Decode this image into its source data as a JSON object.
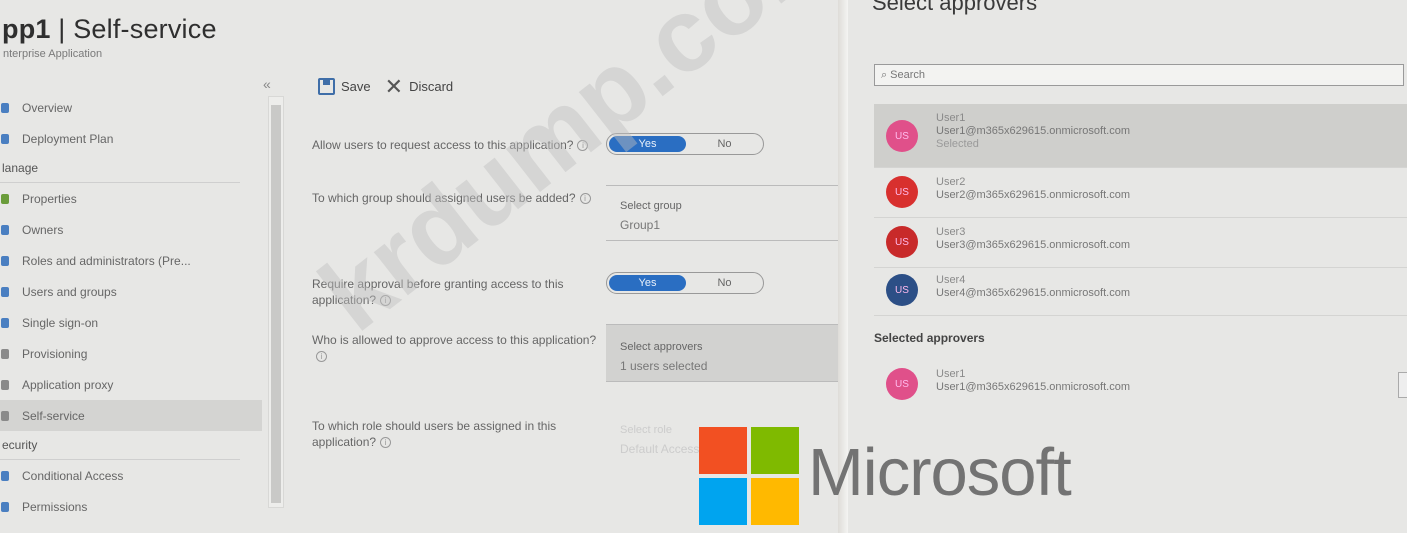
{
  "header": {
    "title_bold": "pp1",
    "title_rest": " | Self-service",
    "subtitle": "nterprise Application"
  },
  "sidebar": {
    "collapse_glyph": "«",
    "items": [
      {
        "type": "item",
        "label": "Overview",
        "color": "#4a7fc1"
      },
      {
        "type": "item",
        "label": "Deployment Plan",
        "color": "#4a7fc1"
      },
      {
        "type": "section",
        "label": "lanage"
      },
      {
        "type": "item",
        "label": "Properties",
        "color": "#6a9c3a"
      },
      {
        "type": "item",
        "label": "Owners",
        "color": "#4a7fc1"
      },
      {
        "type": "item",
        "label": "Roles and administrators (Pre...",
        "color": "#4a7fc1"
      },
      {
        "type": "item",
        "label": "Users and groups",
        "color": "#4a7fc1"
      },
      {
        "type": "item",
        "label": "Single sign-on",
        "color": "#4a7fc1"
      },
      {
        "type": "item",
        "label": "Provisioning",
        "color": "#8a8a8a"
      },
      {
        "type": "item",
        "label": "Application proxy",
        "color": "#8a8a8a"
      },
      {
        "type": "item",
        "label": "Self-service",
        "color": "#8a8a8a",
        "active": true
      },
      {
        "type": "section",
        "label": "ecurity"
      },
      {
        "type": "item",
        "label": "Conditional Access",
        "color": "#4a7fc1"
      },
      {
        "type": "item",
        "label": "Permissions",
        "color": "#4a7fc1"
      }
    ]
  },
  "toolbar": {
    "save_label": "Save",
    "discard_label": "Discard"
  },
  "form": {
    "q1": "Allow users to request access to this application?",
    "q1_yes": "Yes",
    "q1_no": "No",
    "q2": "To which group should assigned users be added?",
    "q2_field_label": "Select group",
    "q2_field_value": "Group1",
    "q3": "Require approval before granting access to this application?",
    "q3_yes": "Yes",
    "q3_no": "No",
    "q4": "Who is allowed to approve access to this application?",
    "q4_field_label": "Select approvers",
    "q4_field_value": "1 users selected",
    "q5": "To which role should users be assigned in this application?",
    "q5_field_label": "Select role",
    "q5_field_value": "Default Access"
  },
  "panel": {
    "title": "Select approvers",
    "search_placeholder": "Search",
    "users": [
      {
        "name": "User1",
        "email": "User1@m365x629615.onmicrosoft.com",
        "status": "Selected",
        "initials": "US",
        "color": "#e0508a"
      },
      {
        "name": "User2",
        "email": "User2@m365x629615.onmicrosoft.com",
        "initials": "US",
        "color": "#d8302e"
      },
      {
        "name": "User3",
        "email": "User3@m365x629615.onmicrosoft.com",
        "initials": "US",
        "color": "#c82a2a"
      },
      {
        "name": "User4",
        "email": "User4@m365x629615.onmicrosoft.com",
        "initials": "US",
        "color": "#2c4f86"
      }
    ],
    "selected_heading": "Selected approvers",
    "selected": [
      {
        "name": "User1",
        "email": "User1@m365x629615.onmicrosoft.com",
        "initials": "US",
        "color": "#e0508a"
      }
    ]
  },
  "branding": {
    "microsoft_text": "Microsoft",
    "watermark": "krdump.com",
    "logo_colors": [
      "#f25022",
      "#7fba00",
      "#00a4ef",
      "#ffb900"
    ]
  }
}
